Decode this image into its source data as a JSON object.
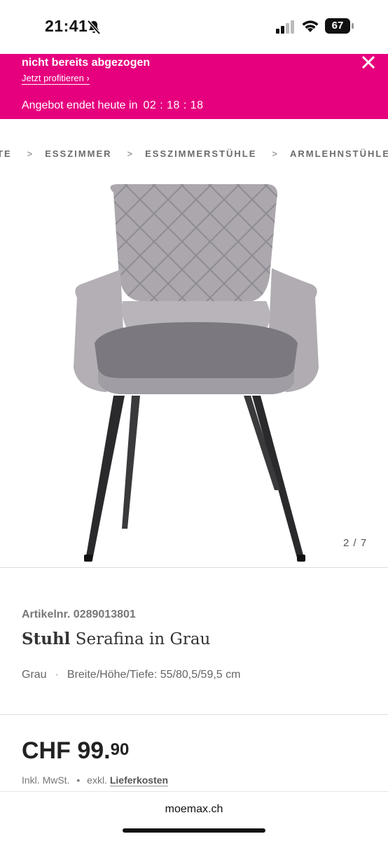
{
  "status_bar": {
    "time": "21:41",
    "battery": "67"
  },
  "promo": {
    "title": "nicht bereits abgezogen",
    "link": "Jetzt profitieren ›",
    "offer_label": "Angebot endet heute in",
    "countdown": "02 : 18 : 18"
  },
  "breadcrumb": {
    "items": [
      "TE",
      "ESSZIMMER",
      "ESSZIMMERSTÜHLE",
      "ARMLEHNSTÜHLE"
    ],
    "separator": ">"
  },
  "gallery": {
    "counter": "2 / 7"
  },
  "product": {
    "article": "Artikelnr. 0289013801",
    "brand": "Stuhl",
    "name": "Serafina in Grau",
    "color": "Grau",
    "meta_separator": "·",
    "dimensions": "Breite/Höhe/Tiefe: 55/80,5/59,5 cm",
    "price_main": "CHF 99.",
    "price_cents": "90",
    "tax_note": "Inkl. MwSt.",
    "tax_separator": "•",
    "delivery_prefix": "exkl.",
    "delivery_link": "Lieferkosten"
  },
  "browser": {
    "url": "moemax.ch"
  },
  "colors": {
    "promo_bg": "#e6007e",
    "chair": "#a9a6ab",
    "legs": "#2a2a2c"
  }
}
